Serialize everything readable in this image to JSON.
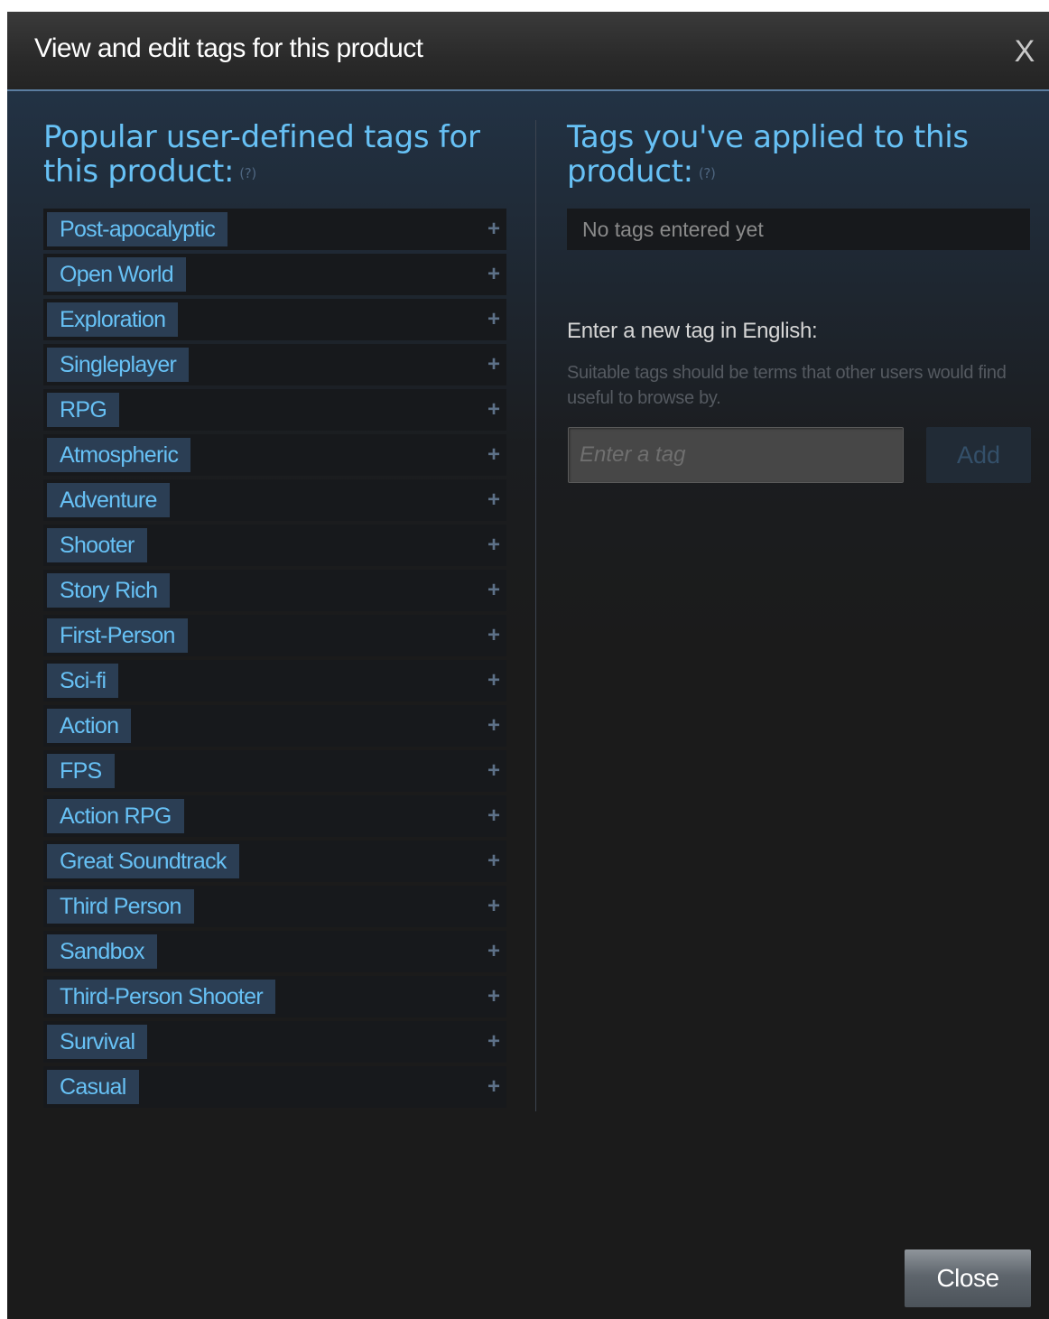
{
  "dialog": {
    "title": "View and edit tags for this product",
    "close_x": "X"
  },
  "popular": {
    "heading": "Popular user-defined tags for this product:",
    "help": "(?)",
    "add_symbol": "+",
    "tags": [
      "Post-apocalyptic",
      "Open World",
      "Exploration",
      "Singleplayer",
      "RPG",
      "Atmospheric",
      "Adventure",
      "Shooter",
      "Story Rich",
      "First-Person",
      "Sci-fi",
      "Action",
      "FPS",
      "Action RPG",
      "Great Soundtrack",
      "Third Person",
      "Sandbox",
      "Third-Person Shooter",
      "Survival",
      "Casual"
    ]
  },
  "applied": {
    "heading": "Tags you've applied to this product:",
    "help": "(?)",
    "empty_text": "No tags entered yet"
  },
  "new_tag": {
    "label": "Enter a new tag in English:",
    "hint": "Suitable tags should be terms that other users would find useful to browse by.",
    "placeholder": "Enter a tag",
    "add_label": "Add"
  },
  "footer": {
    "close_label": "Close"
  },
  "colors": {
    "accent": "#67c1f5",
    "tag_bg": "#2b3e54",
    "panel_dark": "#1b1b1b"
  }
}
